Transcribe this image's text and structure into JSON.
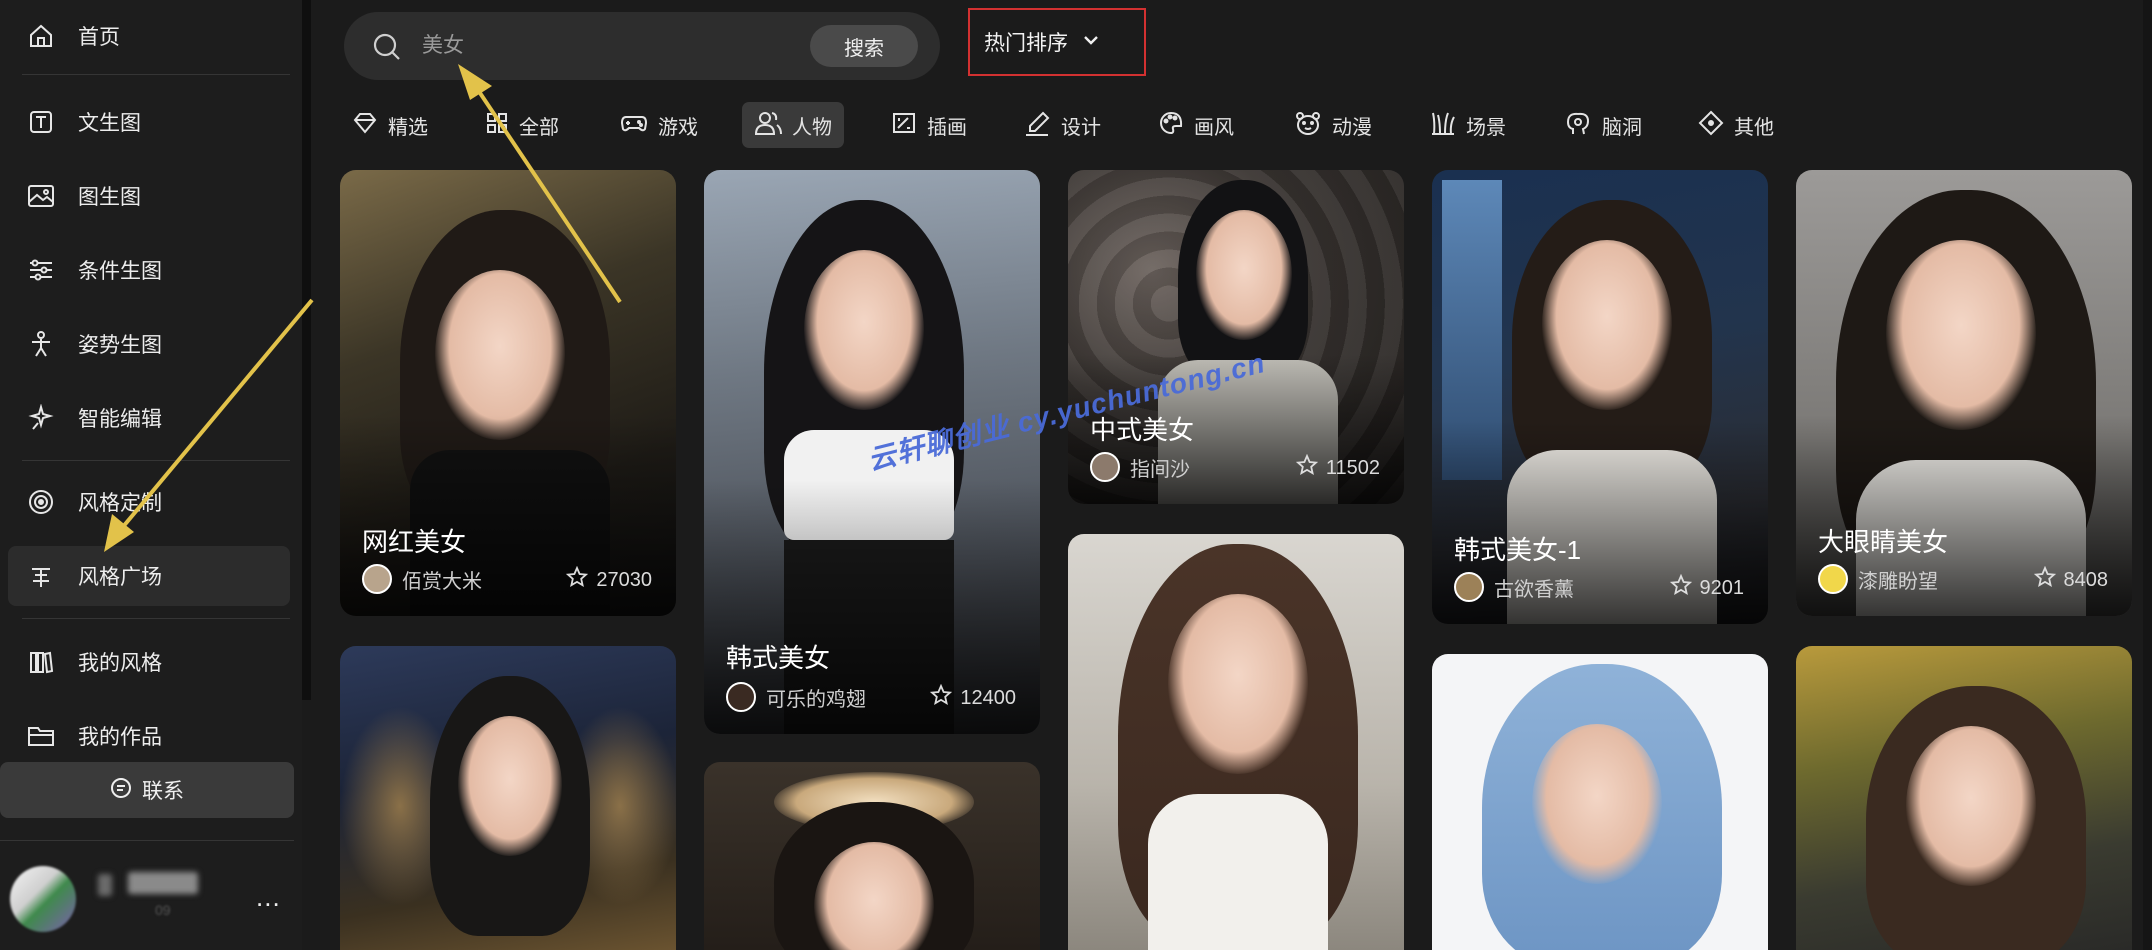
{
  "sidebar": {
    "items": [
      {
        "label": "首页",
        "icon": "home-icon"
      },
      {
        "label": "文生图",
        "icon": "text-box-icon"
      },
      {
        "label": "图生图",
        "icon": "image-icon"
      },
      {
        "label": "条件生图",
        "icon": "sliders-icon"
      },
      {
        "label": "姿势生图",
        "icon": "pose-figure-icon"
      },
      {
        "label": "智能编辑",
        "icon": "magic-sparkle-icon"
      },
      {
        "label": "风格定制",
        "icon": "target-icon"
      },
      {
        "label": "风格广场",
        "icon": "style-square-icon",
        "active": true
      },
      {
        "label": "我的风格",
        "icon": "books-icon"
      },
      {
        "label": "我的作品",
        "icon": "folder-icon"
      }
    ],
    "contact_label": "联系",
    "user": {
      "more_label": "...",
      "sub": "09"
    }
  },
  "search": {
    "value": "",
    "placeholder": "美女",
    "button_label": "搜索"
  },
  "sort": {
    "label": "热门排序",
    "highlight_color": "#d33131"
  },
  "tabs": [
    {
      "label": "精选",
      "icon": "diamond-icon"
    },
    {
      "label": "全部",
      "icon": "grid-icon"
    },
    {
      "label": "游戏",
      "icon": "gamepad-icon"
    },
    {
      "label": "人物",
      "icon": "people-icon",
      "active": true
    },
    {
      "label": "插画",
      "icon": "illustration-icon"
    },
    {
      "label": "设计",
      "icon": "pen-icon"
    },
    {
      "label": "画风",
      "icon": "palette-icon"
    },
    {
      "label": "动漫",
      "icon": "bear-face-icon"
    },
    {
      "label": "场景",
      "icon": "grass-icon"
    },
    {
      "label": "脑洞",
      "icon": "brain-icon"
    },
    {
      "label": "其他",
      "icon": "diamond-dot-icon"
    }
  ],
  "cards": [
    {
      "title": "网红美女",
      "author": "佰赏大米",
      "stars": "27030"
    },
    {
      "title": "韩式美女",
      "author": "可乐的鸡翅",
      "stars": "12400"
    },
    {
      "title": "中式美女",
      "author": "指间沙",
      "stars": "11502"
    },
    {
      "title": "韩式美女-1",
      "author": "古欲香薰",
      "stars": "9201"
    },
    {
      "title": "大眼睛美女",
      "author": "漆雕盼望",
      "stars": "8408"
    }
  ],
  "watermark": "云轩聊创业  cy.yuchuntong.cn",
  "colors": {
    "background": "#1b1b1b",
    "sidebar": "#1d1d1d",
    "annotation_arrow": "#e2c24a",
    "annotation_box": "#d33131"
  }
}
